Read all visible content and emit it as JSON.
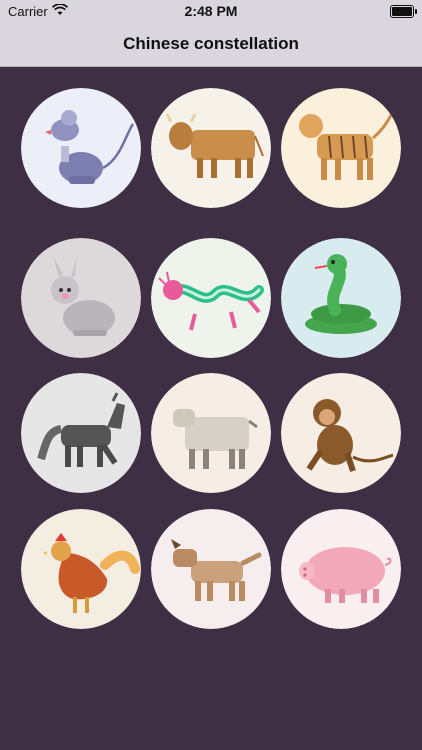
{
  "status_bar": {
    "carrier": "Carrier",
    "time": "2:48 PM",
    "icons": [
      "wifi-icon",
      "battery-icon"
    ]
  },
  "nav": {
    "title": "Chinese constellation"
  },
  "colors": {
    "content_background": "#3f2f45",
    "bar_background": "#d9d6de"
  },
  "zodiac": [
    {
      "animal": "rat",
      "circle": "#eceef8"
    },
    {
      "animal": "ox",
      "circle": "#f6f2ea"
    },
    {
      "animal": "tiger",
      "circle": "#fbf0dc"
    },
    {
      "animal": "rabbit",
      "circle": "#ddd8da"
    },
    {
      "animal": "dragon",
      "circle": "#eef4ec"
    },
    {
      "animal": "snake",
      "circle": "#d8ebef"
    },
    {
      "animal": "horse",
      "circle": "#e6e6e6"
    },
    {
      "animal": "goat",
      "circle": "#f6eee6"
    },
    {
      "animal": "monkey",
      "circle": "#f6ede4"
    },
    {
      "animal": "rooster",
      "circle": "#f4ede2"
    },
    {
      "animal": "dog",
      "circle": "#f6eeee"
    },
    {
      "animal": "pig",
      "circle": "#f9eef0"
    }
  ]
}
